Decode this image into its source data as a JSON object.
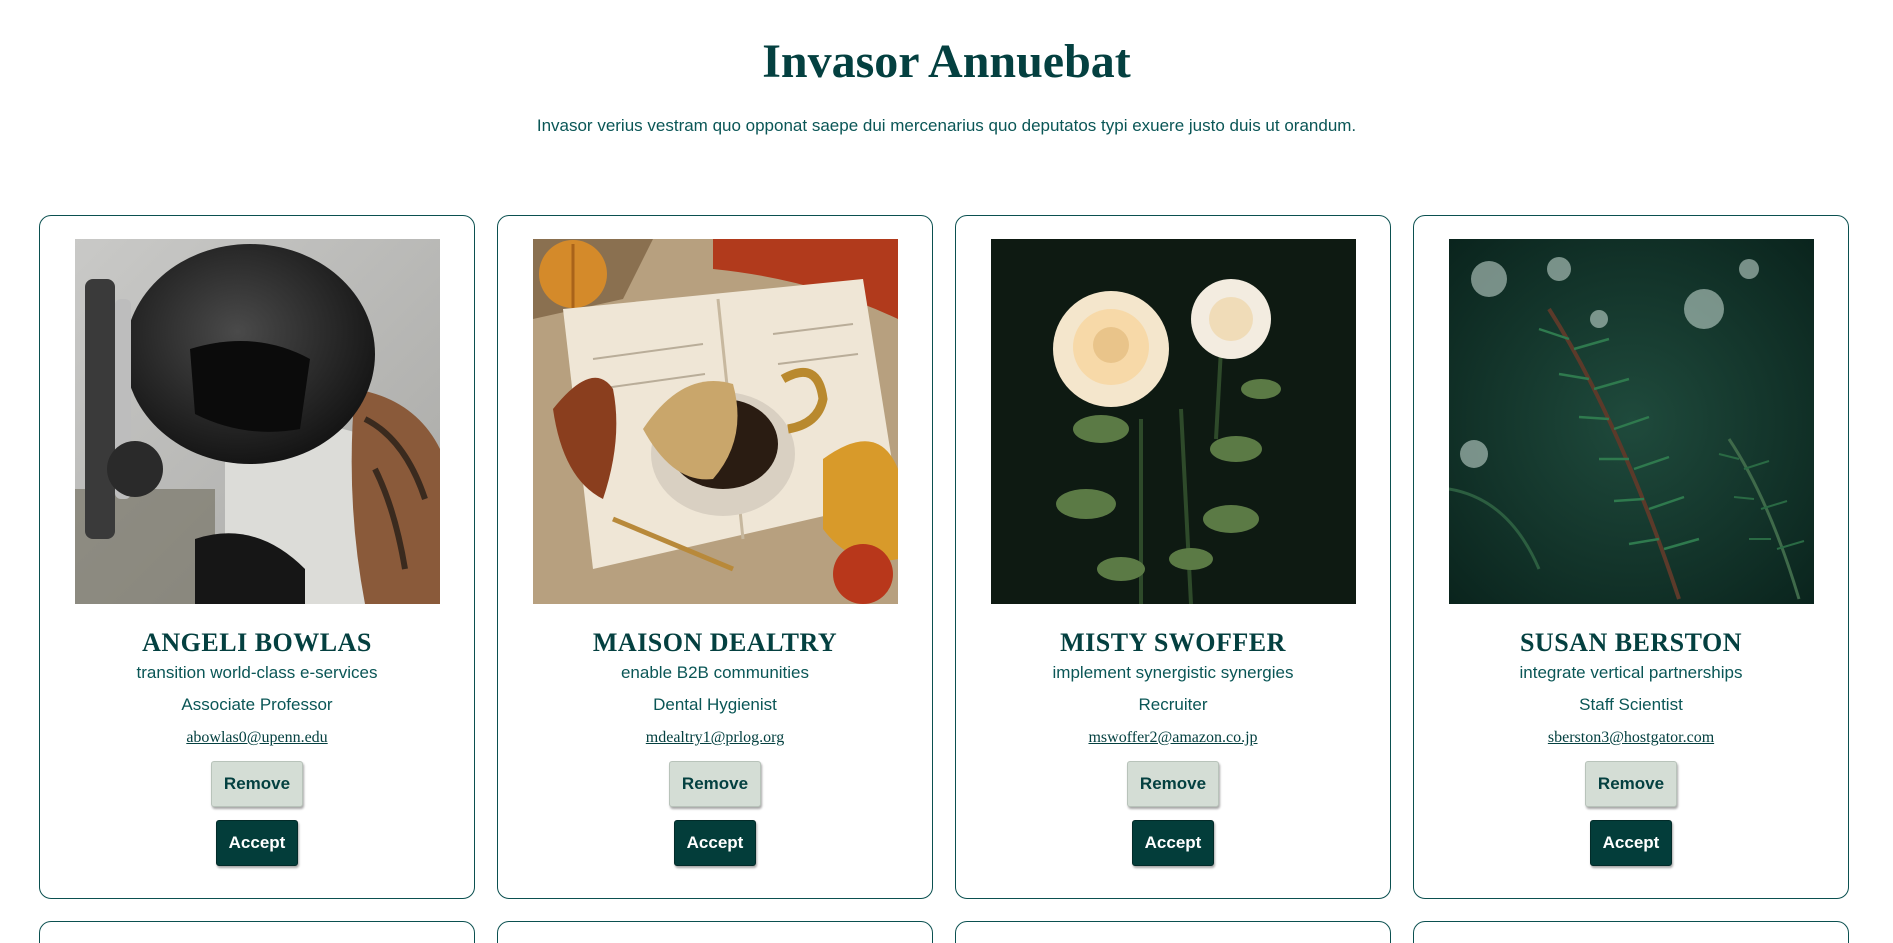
{
  "page": {
    "title": "Invasor Annuebat",
    "subtitle": "Invasor verius vestram quo opponat saepe dui mercenarius quo deputatos typi exuere justo duis ut orandum."
  },
  "colors": {
    "primary": "#044040",
    "border": "#0b5050",
    "remove_bg": "#d4ddd5",
    "accept_bg": "#033d3a"
  },
  "cards": [
    {
      "name": "ANGELI BOWLAS",
      "tagline": "transition world-class e-services",
      "role": "Associate Professor",
      "email": "abowlas0@upenn.edu",
      "photo_subject": "helmeted-motorcyclist-photo",
      "remove_label": "Remove",
      "accept_label": "Accept"
    },
    {
      "name": "MAISON DEALTRY",
      "tagline": "enable B2B communities",
      "role": "Dental Hygienist",
      "email": "mdealtry1@prlog.org",
      "photo_subject": "autumn-coffee-book-photo",
      "remove_label": "Remove",
      "accept_label": "Accept"
    },
    {
      "name": "MISTY SWOFFER",
      "tagline": "implement synergistic synergies",
      "role": "Recruiter",
      "email": "mswoffer2@amazon.co.jp",
      "photo_subject": "white-roses-photo",
      "remove_label": "Remove",
      "accept_label": "Accept"
    },
    {
      "name": "SUSAN BERSTON",
      "tagline": "integrate vertical partnerships",
      "role": "Staff Scientist",
      "email": "sberston3@hostgator.com",
      "photo_subject": "pine-branch-photo",
      "remove_label": "Remove",
      "accept_label": "Accept"
    }
  ]
}
